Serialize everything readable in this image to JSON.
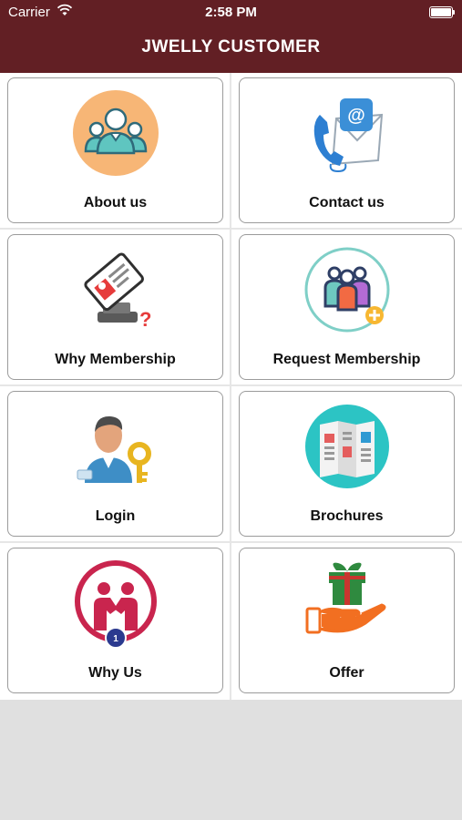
{
  "status_bar": {
    "carrier": "Carrier",
    "time": "2:58 PM"
  },
  "header": {
    "title": "JWELLY CUSTOMER"
  },
  "menu": [
    {
      "label": "About us",
      "icon": "team-icon"
    },
    {
      "label": "Contact us",
      "icon": "phone-email-icon"
    },
    {
      "label": "Why Membership",
      "icon": "membership-card-icon"
    },
    {
      "label": "Request Membership",
      "icon": "add-members-icon"
    },
    {
      "label": "Login",
      "icon": "user-key-icon"
    },
    {
      "label": "Brochures",
      "icon": "brochure-icon"
    },
    {
      "label": "Why Us",
      "icon": "handshake-icon",
      "badge": "1"
    },
    {
      "label": "Offer",
      "icon": "gift-hand-icon"
    }
  ],
  "colors": {
    "header": "#621f24",
    "background": "#e0e0e0"
  }
}
